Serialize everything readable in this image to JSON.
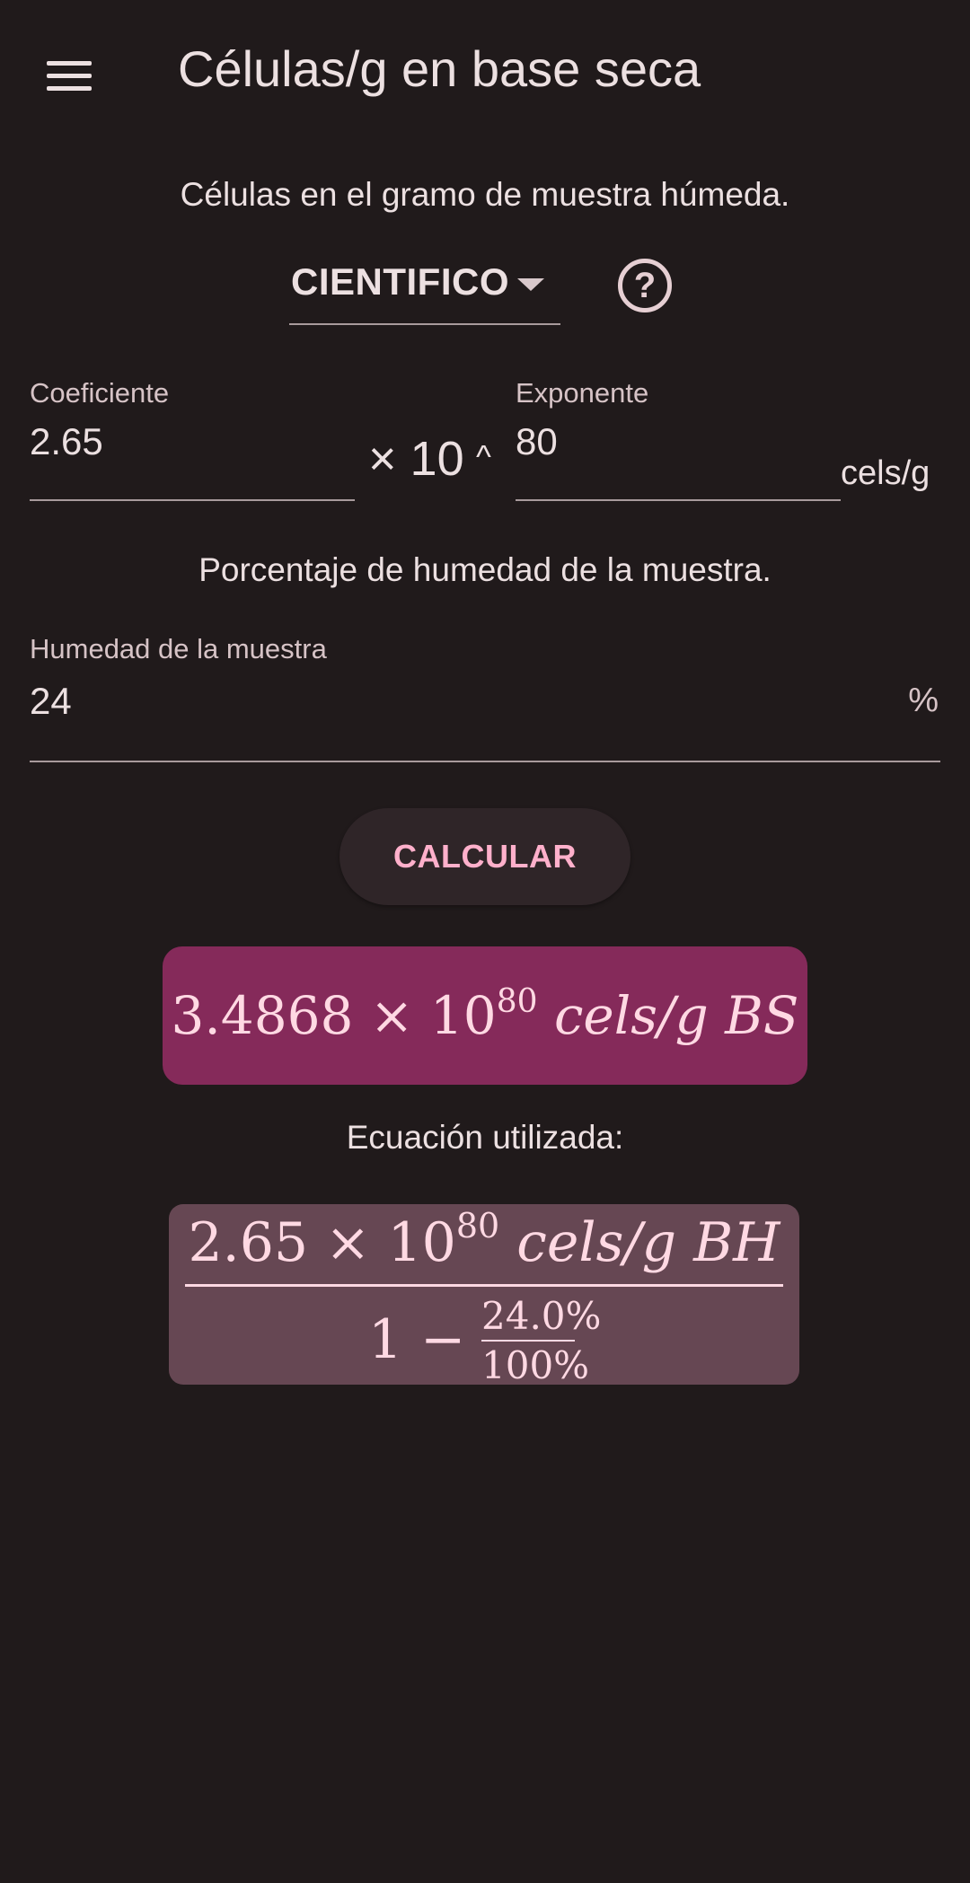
{
  "app_bar": {
    "menu_icon": "menu-icon",
    "title": "Células/g en base seca"
  },
  "wet_sample": {
    "heading": "Células en el gramo de muestra húmeda.",
    "format_select": {
      "value": "CIENTIFICO",
      "icon": "arrow-drop-down-icon"
    },
    "help_icon_glyph": "?",
    "coefficient": {
      "label": "Coeficiente",
      "value": "2.65"
    },
    "times_ten": "× 10",
    "power_symbol": "^",
    "exponent": {
      "label": "Exponente",
      "value": "80"
    },
    "unit": "cels/g"
  },
  "humidity": {
    "heading": "Porcentaje de humedad de la muestra.",
    "label": "Humedad de la muestra",
    "value": "24",
    "suffix": "%"
  },
  "calculate_button": "CALCULAR",
  "result": {
    "mantissa": "3.4868",
    "times_ten": "× 10",
    "exponent": "80",
    "unit": "cels/g BS"
  },
  "equation": {
    "label": "Ecuación utilizada:",
    "numerator": {
      "mantissa": "2.65",
      "times_ten": "× 10",
      "exponent": "80",
      "unit": "cels/g BH"
    },
    "one": "1",
    "minus": "−",
    "humidity_pct": "24.0%",
    "hundred_pct": "100%"
  },
  "colors": {
    "background": "#201a1b",
    "result_box": "#852a5a",
    "equation_box": "#664753",
    "button_text": "#ffb0cb"
  }
}
